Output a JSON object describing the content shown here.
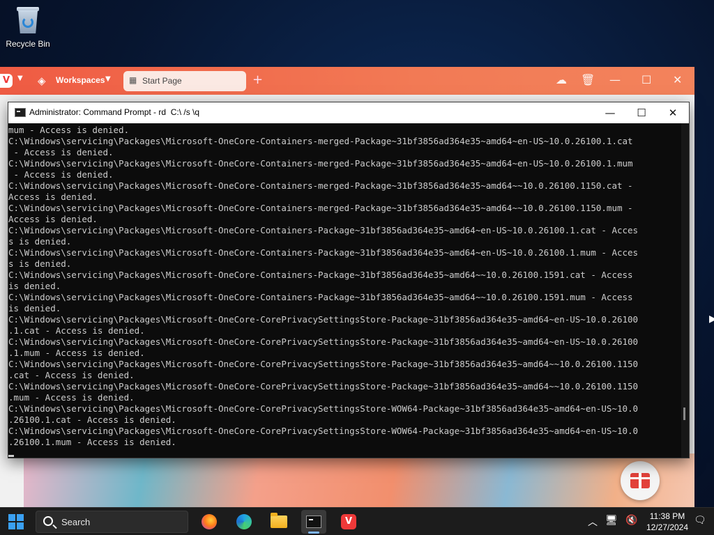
{
  "desktop": {
    "icons": [
      {
        "label": "Recycle Bin",
        "icon": "recycle-bin-icon"
      }
    ]
  },
  "browser": {
    "workspaces_label": "Workspaces",
    "tab_label": "Start Page",
    "accent": "#ef5b43"
  },
  "cmd": {
    "title": "Administrator: Command Prompt - rd  C:\\ /s \\q",
    "lines": [
      "mum - Access is denied.",
      "C:\\Windows\\servicing\\Packages\\Microsoft-OneCore-Containers-merged-Package~31bf3856ad364e35~amd64~en-US~10.0.26100.1.cat",
      " - Access is denied.",
      "C:\\Windows\\servicing\\Packages\\Microsoft-OneCore-Containers-merged-Package~31bf3856ad364e35~amd64~en-US~10.0.26100.1.mum",
      " - Access is denied.",
      "C:\\Windows\\servicing\\Packages\\Microsoft-OneCore-Containers-merged-Package~31bf3856ad364e35~amd64~~10.0.26100.1150.cat -",
      "Access is denied.",
      "C:\\Windows\\servicing\\Packages\\Microsoft-OneCore-Containers-merged-Package~31bf3856ad364e35~amd64~~10.0.26100.1150.mum -",
      "Access is denied.",
      "C:\\Windows\\servicing\\Packages\\Microsoft-OneCore-Containers-Package~31bf3856ad364e35~amd64~en-US~10.0.26100.1.cat - Acces",
      "s is denied.",
      "C:\\Windows\\servicing\\Packages\\Microsoft-OneCore-Containers-Package~31bf3856ad364e35~amd64~en-US~10.0.26100.1.mum - Acces",
      "s is denied.",
      "C:\\Windows\\servicing\\Packages\\Microsoft-OneCore-Containers-Package~31bf3856ad364e35~amd64~~10.0.26100.1591.cat - Access",
      "is denied.",
      "C:\\Windows\\servicing\\Packages\\Microsoft-OneCore-Containers-Package~31bf3856ad364e35~amd64~~10.0.26100.1591.mum - Access",
      "is denied.",
      "C:\\Windows\\servicing\\Packages\\Microsoft-OneCore-CorePrivacySettingsStore-Package~31bf3856ad364e35~amd64~en-US~10.0.26100",
      ".1.cat - Access is denied.",
      "C:\\Windows\\servicing\\Packages\\Microsoft-OneCore-CorePrivacySettingsStore-Package~31bf3856ad364e35~amd64~en-US~10.0.26100",
      ".1.mum - Access is denied.",
      "C:\\Windows\\servicing\\Packages\\Microsoft-OneCore-CorePrivacySettingsStore-Package~31bf3856ad364e35~amd64~~10.0.26100.1150",
      ".cat - Access is denied.",
      "C:\\Windows\\servicing\\Packages\\Microsoft-OneCore-CorePrivacySettingsStore-Package~31bf3856ad364e35~amd64~~10.0.26100.1150",
      ".mum - Access is denied.",
      "C:\\Windows\\servicing\\Packages\\Microsoft-OneCore-CorePrivacySettingsStore-WOW64-Package~31bf3856ad364e35~amd64~en-US~10.0",
      ".26100.1.cat - Access is denied.",
      "C:\\Windows\\servicing\\Packages\\Microsoft-OneCore-CorePrivacySettingsStore-WOW64-Package~31bf3856ad364e35~amd64~en-US~10.0",
      ".26100.1.mum - Access is denied."
    ]
  },
  "taskbar": {
    "search_label": "Search",
    "apps": [
      "firefox-icon",
      "edge-icon",
      "file-explorer-icon",
      "command-prompt-icon",
      "vivaldi-icon"
    ],
    "time": "11:38 PM",
    "date": "12/27/2024"
  }
}
